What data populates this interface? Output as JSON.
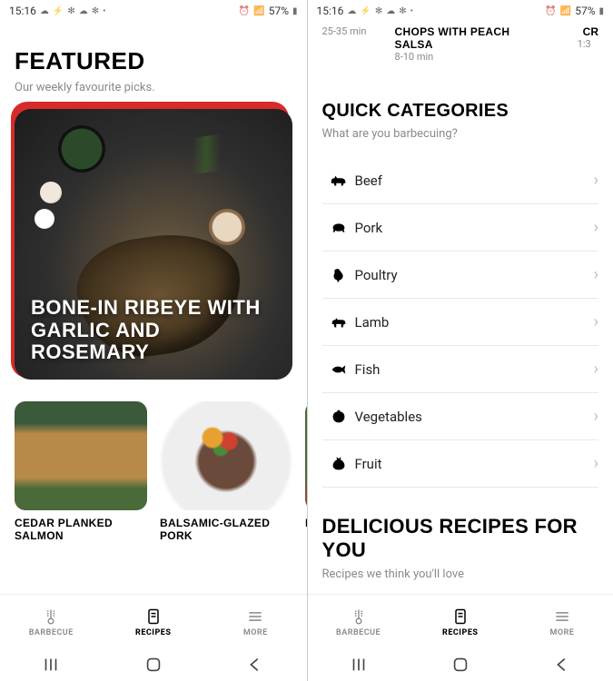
{
  "status": {
    "time": "15:16",
    "battery": "57%"
  },
  "left": {
    "featured": {
      "heading": "FEATURED",
      "sub": "Our weekly favourite picks.",
      "hero_title": "BONE-IN RIBEYE WITH GARLIC AND ROSEMARY"
    },
    "thumbs": [
      {
        "title": "CEDAR PLANKED SALMON"
      },
      {
        "title": "BALSAMIC-GLAZED PORK"
      },
      {
        "title": "PO"
      }
    ]
  },
  "right": {
    "top": {
      "left_time": "25-35 min",
      "mid_title": "CHOPS WITH PEACH SALSA",
      "mid_time": "8-10 min",
      "peek_title": "CR",
      "peek_time": "1:3"
    },
    "quick": {
      "heading": "QUICK CATEGORIES",
      "sub": "What are you barbecuing?",
      "items": [
        {
          "label": "Beef",
          "icon": "cow"
        },
        {
          "label": "Pork",
          "icon": "pig"
        },
        {
          "label": "Poultry",
          "icon": "chicken"
        },
        {
          "label": "Lamb",
          "icon": "lamb"
        },
        {
          "label": "Fish",
          "icon": "fish"
        },
        {
          "label": "Vegetables",
          "icon": "vegetable"
        },
        {
          "label": "Fruit",
          "icon": "fruit"
        }
      ]
    },
    "delicious": {
      "heading": "DELICIOUS RECIPES FOR YOU",
      "sub": "Recipes we think you'll love"
    }
  },
  "tabs": [
    {
      "label": "BARBECUE",
      "active": false
    },
    {
      "label": "RECIPES",
      "active": true
    },
    {
      "label": "MORE",
      "active": false
    }
  ]
}
